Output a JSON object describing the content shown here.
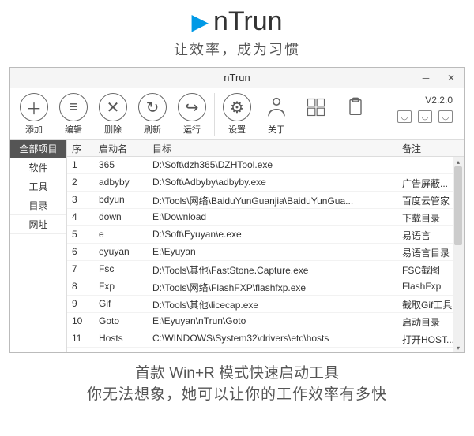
{
  "hero": {
    "title": "nTrun",
    "subtitle": "让效率，成为习惯"
  },
  "window": {
    "title": "nTrun",
    "version": "V2.2.0"
  },
  "toolbar": {
    "add": "添加",
    "edit": "编辑",
    "delete": "删除",
    "refresh": "刷新",
    "run": "运行",
    "settings": "设置",
    "about": "关于"
  },
  "sidebar": {
    "items": [
      {
        "label": "全部项目",
        "active": true
      },
      {
        "label": "软件",
        "active": false
      },
      {
        "label": "工具",
        "active": false
      },
      {
        "label": "目录",
        "active": false
      },
      {
        "label": "网址",
        "active": false
      }
    ]
  },
  "table": {
    "headers": {
      "idx": "序",
      "name": "启动名",
      "target": "目标",
      "note": "备注"
    },
    "rows": [
      {
        "idx": "1",
        "name": "365",
        "target": "D:\\Soft\\dzh365\\DZHTool.exe",
        "note": ""
      },
      {
        "idx": "2",
        "name": "adbyby",
        "target": "D:\\Soft\\Adbyby\\adbyby.exe",
        "note": "广告屏蔽..."
      },
      {
        "idx": "3",
        "name": "bdyun",
        "target": "D:\\Tools\\网络\\BaiduYunGuanjia\\BaiduYunGua...",
        "note": "百度云管家"
      },
      {
        "idx": "4",
        "name": "down",
        "target": "E:\\Download",
        "note": "下载目录"
      },
      {
        "idx": "5",
        "name": "e",
        "target": "D:\\Soft\\Eyuyan\\e.exe",
        "note": "易语言"
      },
      {
        "idx": "6",
        "name": "eyuyan",
        "target": "E:\\Eyuyan",
        "note": "易语言目录"
      },
      {
        "idx": "7",
        "name": "Fsc",
        "target": "D:\\Tools\\其他\\FastStone.Capture.exe",
        "note": "FSC截图"
      },
      {
        "idx": "8",
        "name": "Fxp",
        "target": "D:\\Tools\\网络\\FlashFXP\\flashfxp.exe",
        "note": "FlashFxp"
      },
      {
        "idx": "9",
        "name": "Gif",
        "target": "D:\\Tools\\其他\\licecap.exe",
        "note": "截取Gif工具"
      },
      {
        "idx": "10",
        "name": "Goto",
        "target": "E:\\Eyuyan\\nTrun\\Goto",
        "note": "启动目录"
      },
      {
        "idx": "11",
        "name": "Hosts",
        "target": "C:\\WINDOWS\\System32\\drivers\\etc\\hosts",
        "note": "打开HOST..."
      }
    ]
  },
  "footer": {
    "line1": "首款 Win+R 模式快速启动工具",
    "line2": "你无法想象，她可以让你的工作效率有多快"
  }
}
